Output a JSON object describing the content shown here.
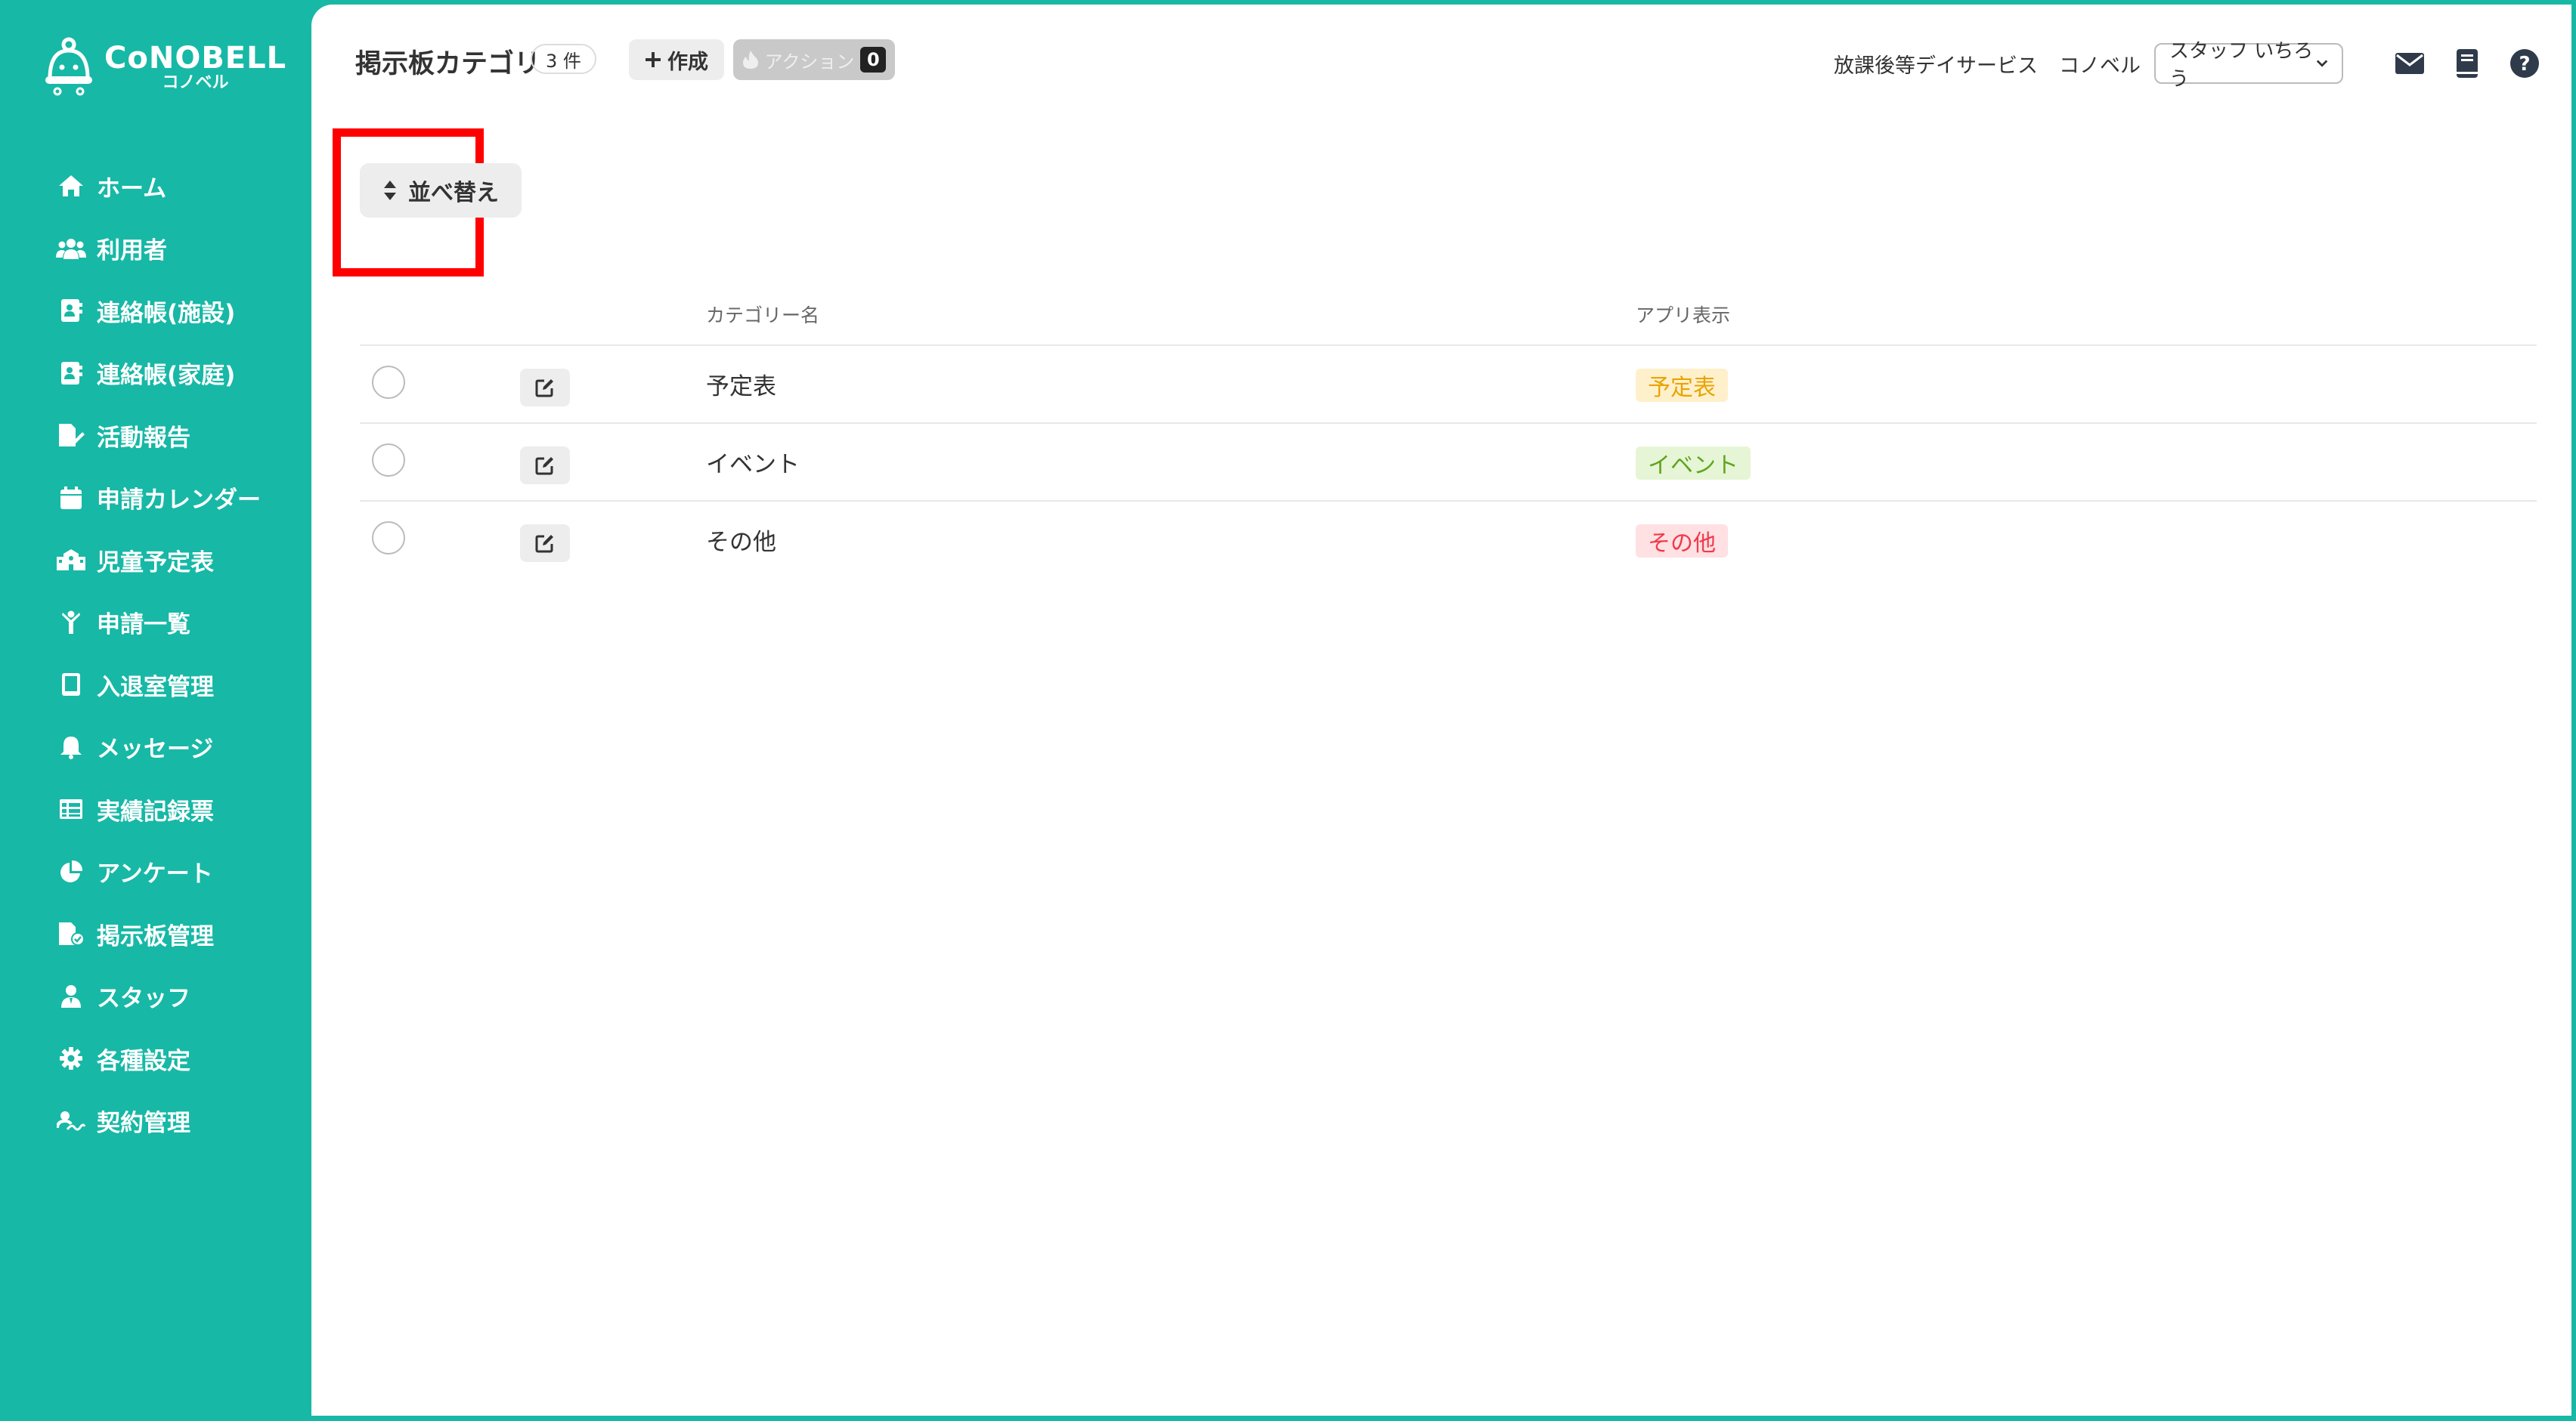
{
  "brand": {
    "name": "CoNOBELL",
    "sub": "コノベル"
  },
  "sidebar": {
    "items": [
      {
        "label": "ホーム",
        "icon": "home-icon"
      },
      {
        "label": "利用者",
        "icon": "users-icon"
      },
      {
        "label": "連絡帳(施設)",
        "icon": "contact-book-icon"
      },
      {
        "label": "連絡帳(家庭)",
        "icon": "contact-book-icon"
      },
      {
        "label": "活動報告",
        "icon": "report-icon"
      },
      {
        "label": "申請カレンダー",
        "icon": "calendar-icon"
      },
      {
        "label": "児童予定表",
        "icon": "school-icon"
      },
      {
        "label": "申請一覧",
        "icon": "child-icon"
      },
      {
        "label": "入退室管理",
        "icon": "tablet-icon"
      },
      {
        "label": "メッセージ",
        "icon": "bell-icon"
      },
      {
        "label": "実績記録票",
        "icon": "table-icon"
      },
      {
        "label": "アンケート",
        "icon": "pie-chart-icon"
      },
      {
        "label": "掲示板管理",
        "icon": "board-icon"
      },
      {
        "label": "スタッフ",
        "icon": "staff-icon"
      },
      {
        "label": "各種設定",
        "icon": "gear-icon"
      },
      {
        "label": "契約管理",
        "icon": "contract-icon"
      }
    ]
  },
  "header": {
    "title": "掲示板カテゴリ",
    "count": "3 件",
    "create_label": "作成",
    "action_label": "アクション",
    "action_count": "0",
    "service_name": "放課後等デイサービス",
    "company_name": "コノベル",
    "staff_select": "スタッフ いちろう"
  },
  "toolbar": {
    "sort_label": "並べ替え"
  },
  "table": {
    "columns": {
      "name": "カテゴリー名",
      "app_display": "アプリ表示"
    },
    "rows": [
      {
        "name": "予定表",
        "tag": "予定表"
      },
      {
        "name": "イベント",
        "tag": "イベント"
      },
      {
        "name": "その他",
        "tag": "その他"
      }
    ]
  },
  "colors": {
    "brand_teal": "#17b8a6",
    "highlight_red": "#ff0000",
    "tag_orange_bg": "#fff0cc",
    "tag_orange_fg": "#e8a400",
    "tag_green_bg": "#e6f5d6",
    "tag_green_fg": "#5fa61e",
    "tag_red_bg": "#ffe0e3",
    "tag_red_fg": "#f03a4a"
  }
}
